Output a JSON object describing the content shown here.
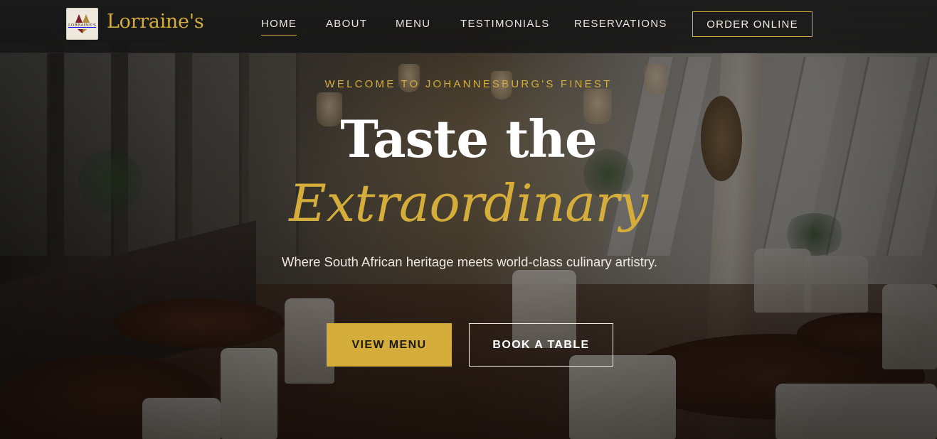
{
  "brand": {
    "badge_text": "LORRAINE'S",
    "name": "Lorraine's"
  },
  "nav": {
    "items": [
      {
        "label": "HOME",
        "active": true
      },
      {
        "label": "ABOUT",
        "active": false
      },
      {
        "label": "MENU",
        "active": false
      },
      {
        "label": "TESTIMONIALS",
        "active": false
      },
      {
        "label": "RESERVATIONS",
        "active": false
      }
    ],
    "order_button": "ORDER ONLINE"
  },
  "hero": {
    "eyebrow": "WELCOME TO JOHANNESBURG'S FINEST",
    "headline": "Taste the",
    "headline_accent": "Extraordinary",
    "subtext": "Where South African heritage meets world-class culinary artistry.",
    "primary_cta": "VIEW MENU",
    "secondary_cta": "BOOK A TABLE"
  },
  "colors": {
    "accent_gold": "#d4ad3a",
    "navbar_bg": "#1a1a1a",
    "text_light": "#f0ece4"
  },
  "icons": {
    "logo": "lorraines-crest-logo"
  }
}
